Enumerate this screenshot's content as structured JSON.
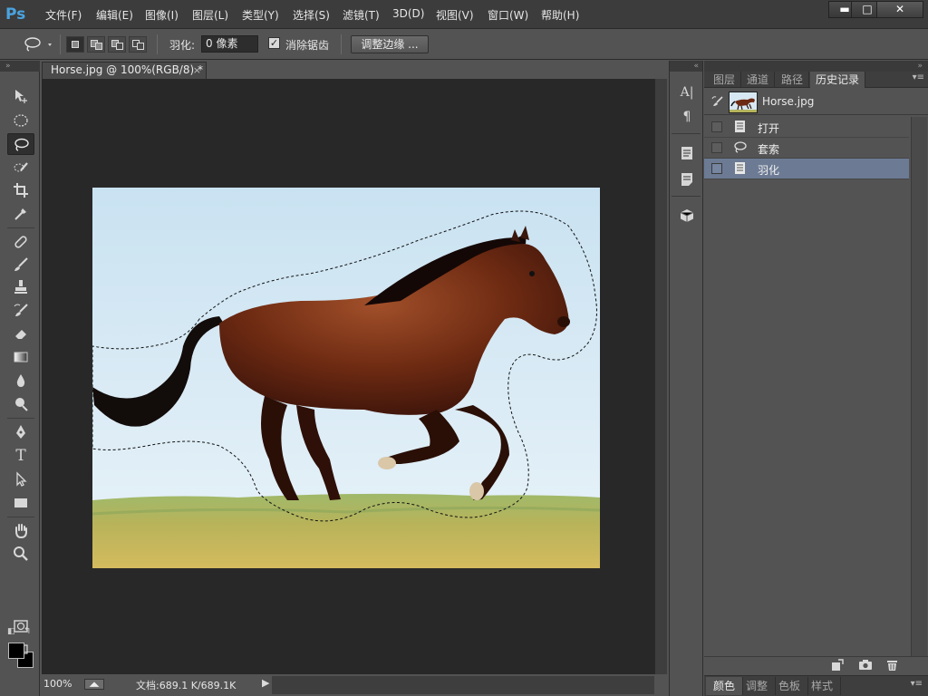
{
  "app": {
    "logo": "Ps"
  },
  "menu": [
    "文件(F)",
    "编辑(E)",
    "图像(I)",
    "图层(L)",
    "类型(Y)",
    "选择(S)",
    "滤镜(T)",
    "3D(D)",
    "视图(V)",
    "窗口(W)",
    "帮助(H)"
  ],
  "window_controls": {
    "minimize": "▬",
    "maximize": "□",
    "close": "✕"
  },
  "options": {
    "feather_label": "羽化:",
    "feather_value": "0 像素",
    "antialias_label": "消除锯齿",
    "antialias_checked": true,
    "antialias_check_glyph": "✓",
    "refine_edge": "调整边缘 ..."
  },
  "document": {
    "tab_title": "Horse.jpg @ 100%(RGB/8) *",
    "tab_close": "×",
    "zoom": "100%",
    "doc_size": "文档:689.1 K/689.1K"
  },
  "panel": {
    "tabs": [
      "图层",
      "通道",
      "路径",
      "历史记录"
    ],
    "active_tab": "历史记录",
    "snapshot_label": "Horse.jpg",
    "history": [
      {
        "label": "打开",
        "icon": "document-icon",
        "selected": false
      },
      {
        "label": "套索",
        "icon": "lasso-icon",
        "selected": false
      },
      {
        "label": "羽化",
        "icon": "document-icon",
        "selected": true
      }
    ]
  },
  "bottom_tabs": [
    "颜色",
    "调整",
    "色板",
    "样式"
  ],
  "colors": {
    "foreground": "#000000",
    "background": "#000000",
    "selected_history": "#6c7a94",
    "ps_logo": "#4aa3df"
  },
  "icons": {
    "tools": [
      "move-icon",
      "elliptical-marquee-icon",
      "lasso-icon",
      "quick-selection-icon",
      "crop-icon",
      "eyedropper-icon",
      "healing-brush-icon",
      "brush-icon",
      "clone-stamp-icon",
      "history-brush-icon",
      "eraser-icon",
      "gradient-icon",
      "blur-icon",
      "dodge-icon",
      "pen-icon",
      "type-icon",
      "path-selection-icon",
      "rectangle-icon",
      "hand-icon",
      "zoom-icon"
    ],
    "dock": [
      "character-icon",
      "paragraph-icon",
      "notes-icon",
      "properties-icon",
      "3d-icon"
    ],
    "footer": [
      "new-document-from-state-icon",
      "new-snapshot-icon",
      "delete-state-icon"
    ]
  }
}
